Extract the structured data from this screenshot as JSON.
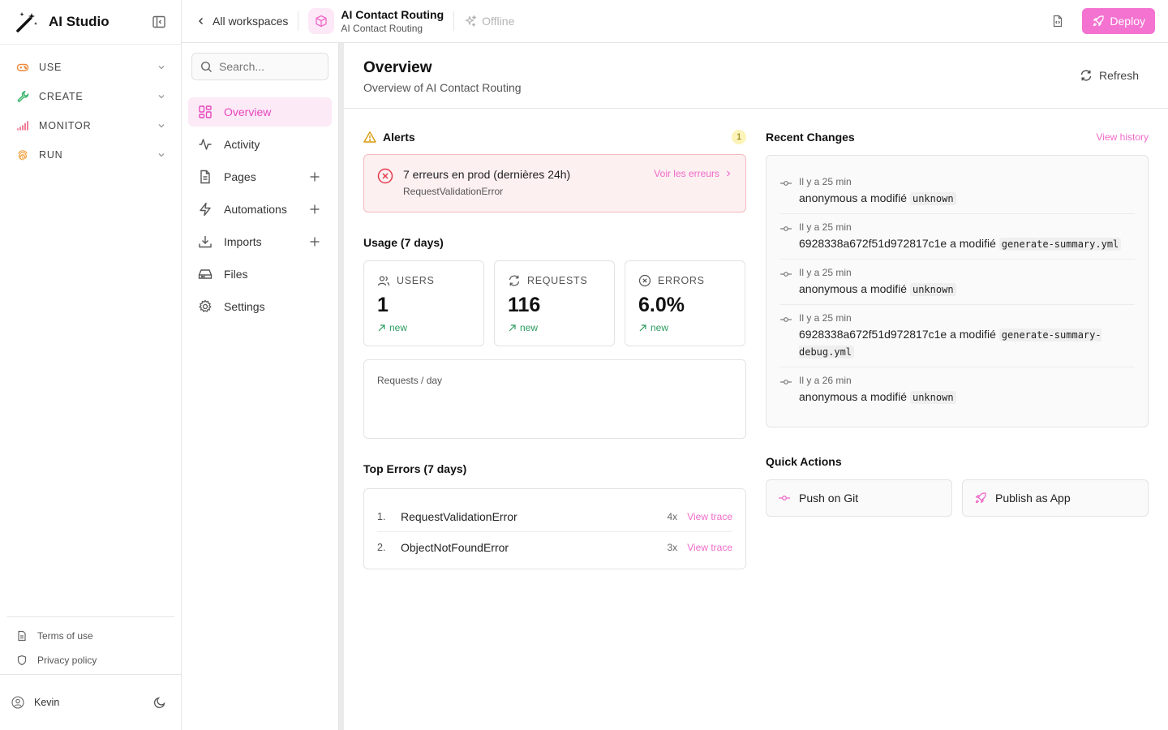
{
  "app": {
    "title": "AI Studio"
  },
  "rail": {
    "items": [
      {
        "label": "USE",
        "icon": "gamepad-icon",
        "color": "#f08a3c"
      },
      {
        "label": "CREATE",
        "icon": "wrench-icon",
        "color": "#3bb56c"
      },
      {
        "label": "MONITOR",
        "icon": "signal-bars-icon",
        "color": "#e6456b"
      },
      {
        "label": "RUN",
        "icon": "fingerprint-icon",
        "color": "#f0a03c"
      }
    ],
    "footer": {
      "terms": "Terms of use",
      "privacy": "Privacy policy"
    },
    "user": {
      "name": "Kevin"
    }
  },
  "topbar": {
    "back_label": "All workspaces",
    "project_title": "AI Contact Routing",
    "project_subtitle": "AI Contact Routing",
    "status": "Offline",
    "deploy_label": "Deploy"
  },
  "subnav": {
    "search_placeholder": "Search...",
    "items": [
      {
        "label": "Overview",
        "active": true,
        "icon": "layout-grid-icon"
      },
      {
        "label": "Activity",
        "icon": "activity-icon"
      },
      {
        "label": "Pages",
        "icon": "file-icon",
        "add": true
      },
      {
        "label": "Automations",
        "icon": "lightning-icon",
        "add": true
      },
      {
        "label": "Imports",
        "icon": "download-icon",
        "add": true
      },
      {
        "label": "Files",
        "icon": "hard-drive-icon"
      },
      {
        "label": "Settings",
        "icon": "gear-icon"
      }
    ]
  },
  "main": {
    "title": "Overview",
    "subtitle": "Overview of AI Contact Routing",
    "refresh_label": "Refresh",
    "alerts": {
      "title": "Alerts",
      "count": "1",
      "message": "7 erreurs en prod (dernières 24h)",
      "detail": "RequestValidationError",
      "link": "Voir les erreurs"
    },
    "usage": {
      "title": "Usage (7 days)",
      "stats": [
        {
          "label": "USERS",
          "value": "1",
          "delta": "new"
        },
        {
          "label": "REQUESTS",
          "value": "116",
          "delta": "new"
        },
        {
          "label": "ERRORS",
          "value": "6.0%",
          "delta": "new"
        }
      ],
      "chart_label": "Requests / day"
    },
    "top_errors": {
      "title": "Top Errors (7 days)",
      "rows": [
        {
          "num": "1.",
          "name": "RequestValidationError",
          "count": "4x",
          "link": "View trace"
        },
        {
          "num": "2.",
          "name": "ObjectNotFoundError",
          "count": "3x",
          "link": "View trace"
        }
      ]
    },
    "recent_changes": {
      "title": "Recent Changes",
      "link": "View history",
      "items": [
        {
          "time": "Il y a 25 min",
          "who": "anonymous",
          "verb": "a modifié",
          "file": "unknown"
        },
        {
          "time": "Il y a 25 min",
          "who": "6928338a672f51d972817c1e",
          "verb": "a modifié",
          "file": "generate-summary.yml"
        },
        {
          "time": "Il y a 25 min",
          "who": "anonymous",
          "verb": "a modifié",
          "file": "unknown"
        },
        {
          "time": "Il y a 25 min",
          "who": "6928338a672f51d972817c1e",
          "verb": "a modifié",
          "file": "generate-summary-debug.yml"
        },
        {
          "time": "Il y a 26 min",
          "who": "anonymous",
          "verb": "a modifié",
          "file": "unknown"
        }
      ]
    },
    "quick_actions": {
      "title": "Quick Actions",
      "push": "Push on Git",
      "publish": "Publish as App"
    }
  },
  "colors": {
    "accent": "#f472d0",
    "accent_text": "#f06ac9",
    "alert_bg": "#fdf0f1",
    "alert_red": "#e43b4f",
    "success": "#2c9c5f"
  }
}
